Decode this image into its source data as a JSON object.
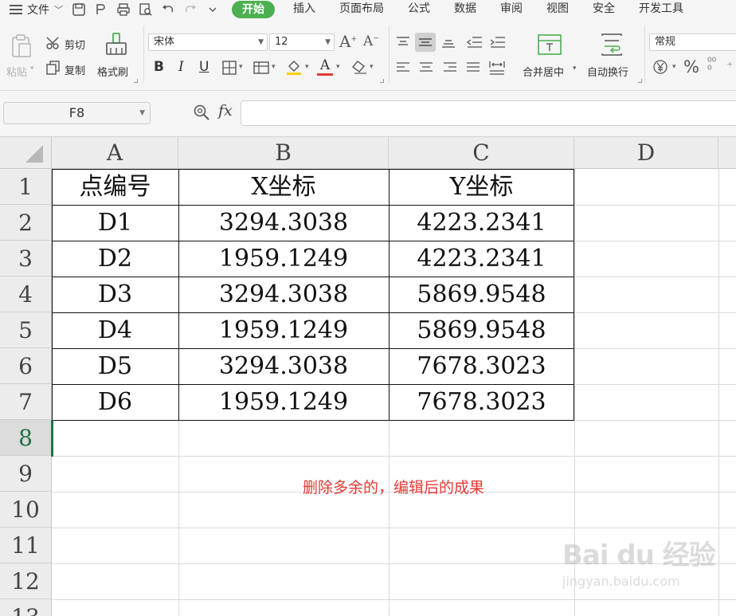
{
  "menubar": {
    "file_label": "文件",
    "tabs": [
      "开始",
      "插入",
      "页面布局",
      "公式",
      "数据",
      "审阅",
      "视图",
      "安全",
      "开发工具"
    ]
  },
  "ribbon": {
    "paste": "粘贴",
    "cut": "剪切",
    "copy": "复制",
    "format_painter": "格式刷",
    "font_name": "宋体",
    "font_size": "12",
    "merge_center": "合并居中",
    "wrap_text": "自动换行",
    "number_format": "常规"
  },
  "formula_bar": {
    "cell_ref": "F8",
    "fx": "fx",
    "value": ""
  },
  "sheet": {
    "columns": [
      "A",
      "B",
      "C",
      "D"
    ],
    "rows": [
      "1",
      "2",
      "3",
      "4",
      "5",
      "6",
      "7",
      "8",
      "9",
      "10",
      "11",
      "12",
      "13"
    ],
    "selected_row": "8",
    "table": [
      [
        "点编号",
        "X坐标",
        "Y坐标"
      ],
      [
        "D1",
        "3294.3038",
        "4223.2341"
      ],
      [
        "D2",
        "1959.1249",
        "4223.2341"
      ],
      [
        "D3",
        "3294.3038",
        "5869.9548"
      ],
      [
        "D4",
        "1959.1249",
        "5869.9548"
      ],
      [
        "D5",
        "3294.3038",
        "7678.3023"
      ],
      [
        "D6",
        "1959.1249",
        "7678.3023"
      ]
    ],
    "annotation": "删除多余的，编辑后的成果",
    "annotation_color": "#e53935"
  },
  "watermark": {
    "brand": "Bai du 经验",
    "url": "jingyan.baidu.com"
  },
  "colors": {
    "accent": "#4caf50",
    "active": "#217346"
  }
}
